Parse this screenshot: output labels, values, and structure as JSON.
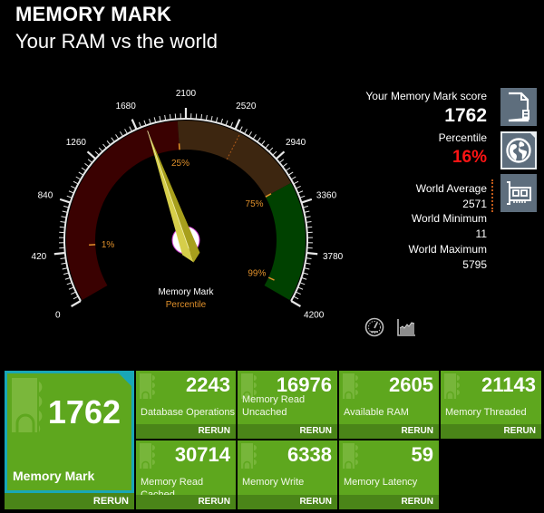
{
  "header": {
    "title": "MEMORY MARK",
    "subtitle": "Your RAM vs the world"
  },
  "gauge": {
    "min": 0,
    "max": 4200,
    "value": 1762,
    "major_step": 420,
    "minor_per_major": 10,
    "tick_labels": [
      "0",
      "420",
      "840",
      "1260",
      "1680",
      "2100",
      "2520",
      "2940",
      "3360",
      "3780",
      "4200"
    ],
    "bands": [
      {
        "name": "low",
        "from": 0,
        "to": 2030,
        "color": "#3a0101"
      },
      {
        "name": "mid",
        "from": 2030,
        "to": 3175,
        "color": "#3d2610"
      },
      {
        "name": "high",
        "from": 3175,
        "to": 4200,
        "color": "#004100"
      }
    ],
    "percentile_markers": [
      {
        "label": "1%",
        "value": 476
      },
      {
        "label": "25%",
        "value": 2030
      },
      {
        "label": "75%",
        "value": 3175
      },
      {
        "label": "99%",
        "value": 4100
      }
    ],
    "world_average_marker": 2571,
    "center_label": "Memory Mark",
    "center_sublabel": "Percentile",
    "colors": {
      "needle_light": "#d6ce4a",
      "needle_dark": "#a79f1c",
      "marker": "#e0902a",
      "ring": "#e6e6e6"
    }
  },
  "summary": {
    "score_label": "Your Memory Mark score",
    "score": "1762",
    "percentile_label": "Percentile",
    "percentile": "16%",
    "world_average_label": "World Average",
    "world_average": "2571",
    "world_minimum_label": "World Minimum",
    "world_minimum": "11",
    "world_maximum_label": "World Maximum",
    "world_maximum": "5795",
    "percentile_color": "#ff1414"
  },
  "side_buttons": [
    {
      "name": "report-icon",
      "selected": false
    },
    {
      "name": "globe-icon",
      "selected": true
    },
    {
      "name": "ram-card-icon",
      "selected": false
    }
  ],
  "view_toggles": [
    {
      "name": "gauge-icon",
      "selected": true
    },
    {
      "name": "area-chart-icon",
      "selected": false
    }
  ],
  "tiles": {
    "main": {
      "value": "1762",
      "label": "Memory Mark",
      "rerun": "RERUN"
    },
    "items": [
      {
        "value": "2243",
        "label": "Database Operations",
        "rerun": "RERUN"
      },
      {
        "value": "16976",
        "label": "Memory Read Uncached",
        "rerun": "RERUN"
      },
      {
        "value": "2605",
        "label": "Available RAM",
        "rerun": "RERUN"
      },
      {
        "value": "21143",
        "label": "Memory Threaded",
        "rerun": "RERUN"
      },
      {
        "value": "30714",
        "label": "Memory Read Cached",
        "rerun": "RERUN"
      },
      {
        "value": "6338",
        "label": "Memory Write",
        "rerun": "RERUN"
      },
      {
        "value": "59",
        "label": "Memory Latency",
        "rerun": "RERUN"
      }
    ],
    "colors": {
      "tile": "#5ea71e",
      "rerun_bar": "#4a8518",
      "accent": "#19a7b7"
    }
  }
}
